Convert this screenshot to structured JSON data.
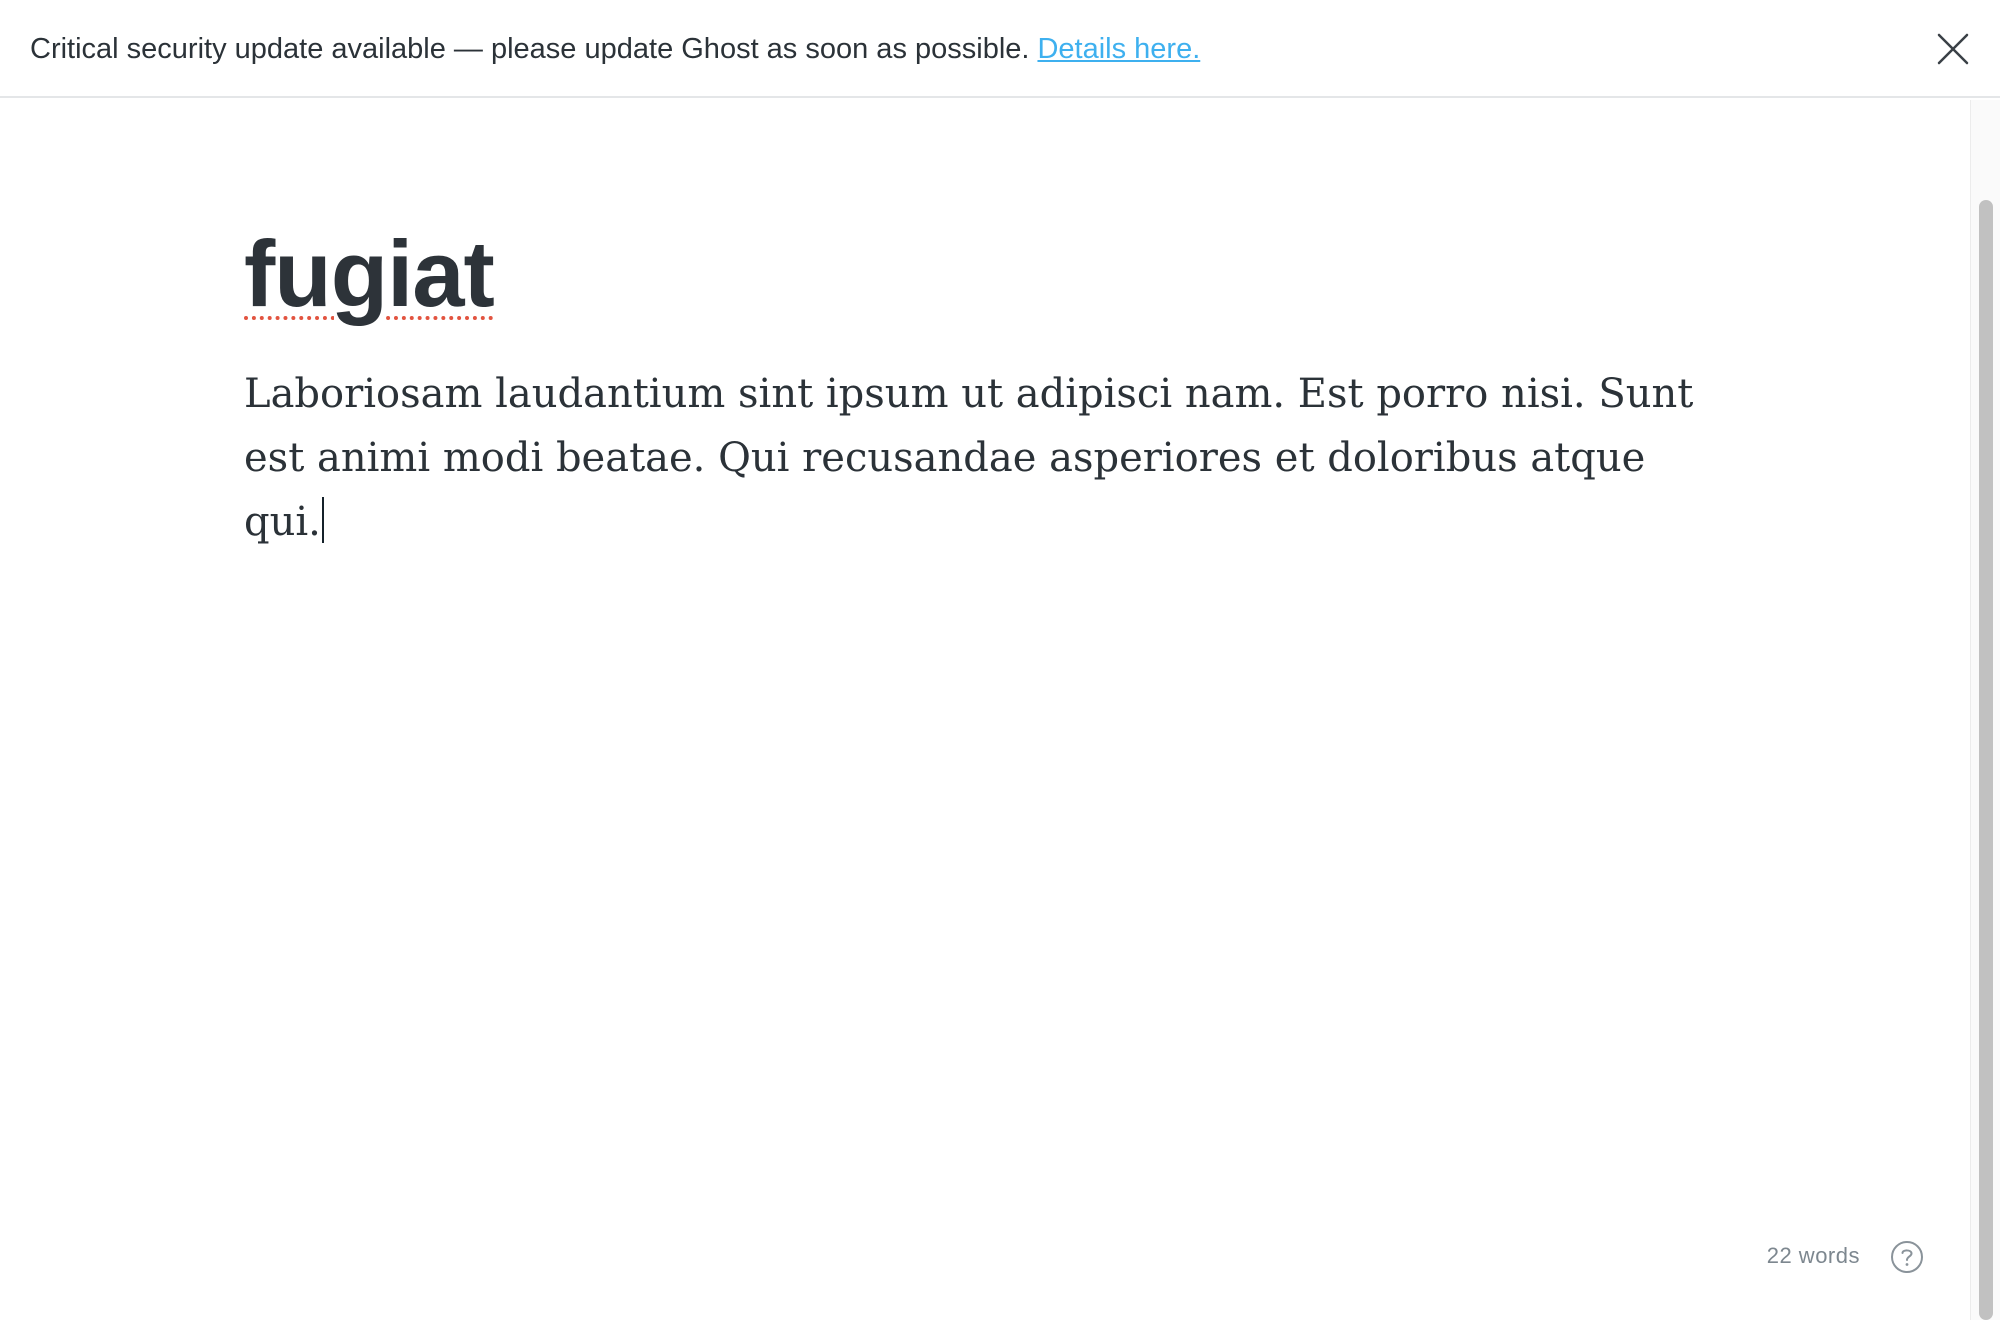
{
  "banner": {
    "message": "Critical security update available — please update Ghost as soon as possible.",
    "link_label": "Details here.",
    "close_icon": "close-icon"
  },
  "editor": {
    "title": "fugiat",
    "body": "Laboriosam laudantium sint ipsum ut adipisci nam. Est porro nisi. Sunt est animi modi beatae. Qui recusandae asperiores et doloribus atque qui."
  },
  "footer": {
    "word_count": "22 words",
    "help_icon": "help-circle-icon"
  },
  "colors": {
    "link": "#3eb0ef",
    "text": "#2b3238",
    "spellcheck_underline": "#e25440",
    "muted": "#7d878f"
  }
}
